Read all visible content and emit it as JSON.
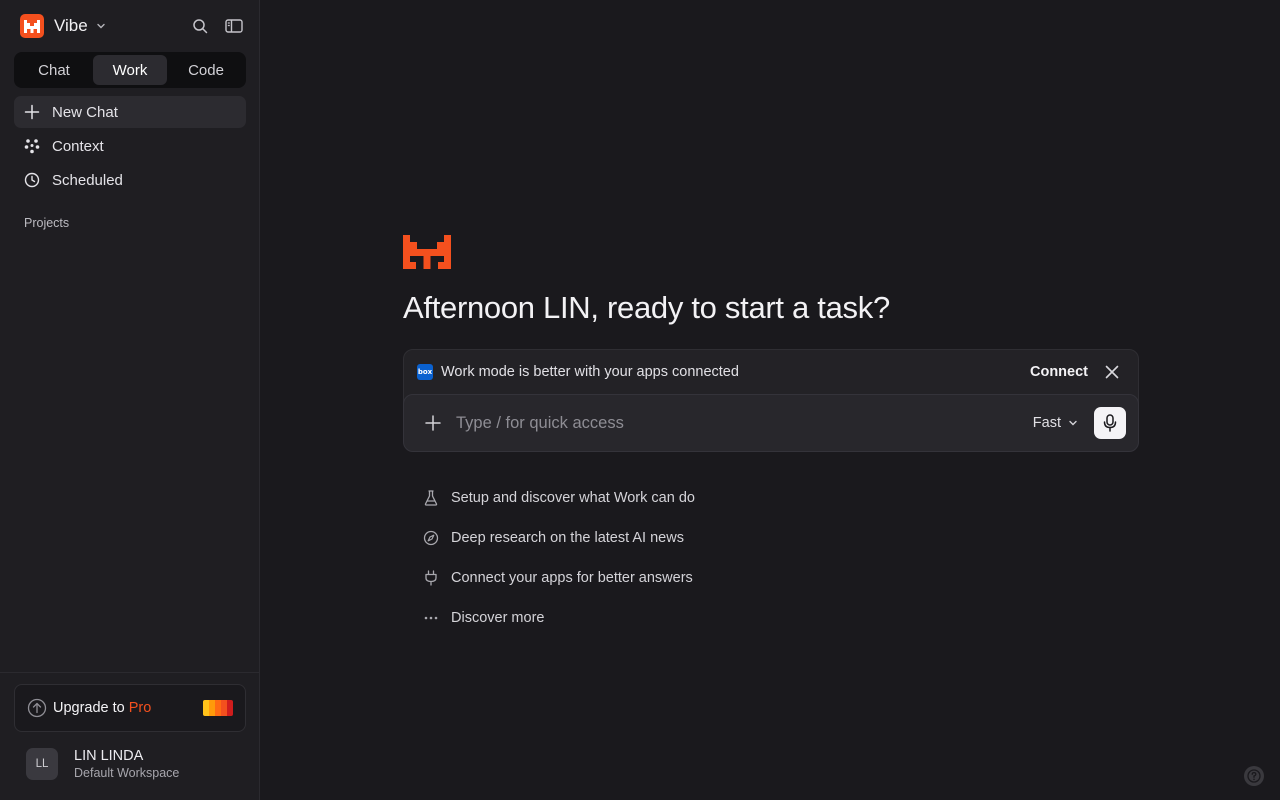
{
  "brand": {
    "name": "Vibe",
    "accent": "#f4501e"
  },
  "mode_tabs": [
    {
      "label": "Chat",
      "active": false
    },
    {
      "label": "Work",
      "active": true
    },
    {
      "label": "Code",
      "active": false
    }
  ],
  "nav": [
    {
      "label": "New Chat",
      "icon": "plus-icon"
    },
    {
      "label": "Context",
      "icon": "context-nodes-icon"
    },
    {
      "label": "Scheduled",
      "icon": "clock-icon"
    }
  ],
  "projects_label": "Projects",
  "upgrade": {
    "prefix": "Upgrade to",
    "pro": "Pro"
  },
  "user": {
    "initials": "LL",
    "name": "LIN LINDA",
    "workspace": "Default Workspace"
  },
  "main": {
    "greeting": "Afternoon LIN, ready to start a task?",
    "banner": {
      "badge": "box",
      "text": "Work mode is better with your apps connected",
      "connect_label": "Connect"
    },
    "input": {
      "placeholder": "Type / for quick access",
      "speed_label": "Fast"
    },
    "suggestions": [
      {
        "icon": "flask-icon",
        "text": "Setup and discover what Work can do"
      },
      {
        "icon": "compass-icon",
        "text": "Deep research on the latest AI news"
      },
      {
        "icon": "plug-icon",
        "text": "Connect your apps for better answers"
      },
      {
        "icon": "more-dots-icon",
        "text": "Discover more"
      }
    ]
  }
}
